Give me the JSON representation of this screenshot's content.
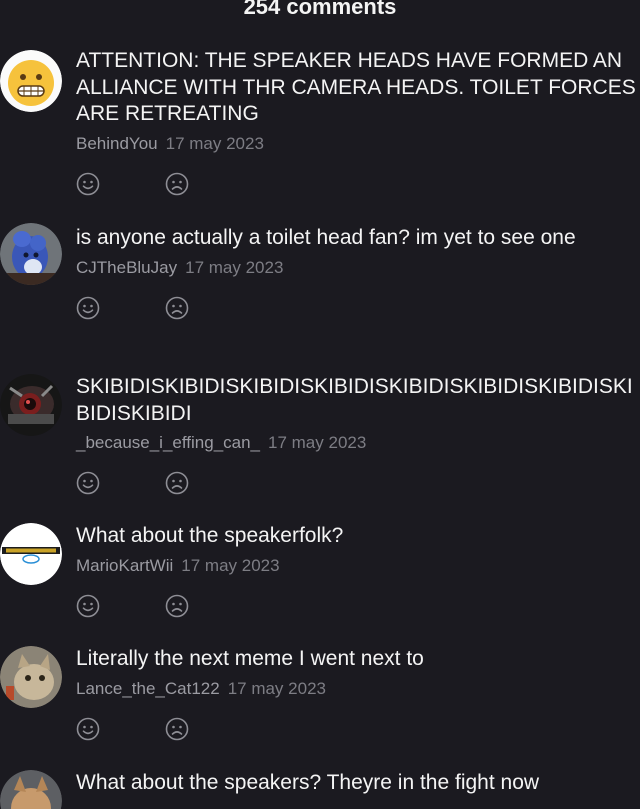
{
  "header": {
    "title": "254 comments"
  },
  "comments": [
    {
      "avatar_icon": "grimace-emoji-avatar-icon",
      "text": "ATTENTION: THE SPEAKER HEADS HAVE FORMED AN ALLIANCE WITH THR CAMERA HEADS. TOILET FORCES ARE RETREATING",
      "author": "BehindYou",
      "date": "17 may 2023"
    },
    {
      "avatar_icon": "blue-creature-avatar-icon",
      "text": "is anyone actually a toilet head fan? im yet to see one",
      "author": "CJTheBluJay",
      "date": "17 may 2023"
    },
    {
      "avatar_icon": "dark-robot-avatar-icon",
      "text": "SKIBIDISKIBIDISKIBIDISKIBIDISKIBIDISKIBIDISKIBIDISKIBIDISKIBIDI",
      "author": "_because_i_effing_can_",
      "date": "17 may 2023"
    },
    {
      "avatar_icon": "mario-kart-wii-logo-avatar-icon",
      "text": "What about the speakerfolk?",
      "author": "MarioKartWii",
      "date": "17 may 2023"
    },
    {
      "avatar_icon": "cat-photo-avatar-icon",
      "text": "Literally the next meme I went next to",
      "author": "Lance_the_Cat122",
      "date": "17 may 2023"
    },
    {
      "avatar_icon": "dog-photo-avatar-icon",
      "text": "What about the speakers? Theyre in the fight now",
      "author": "",
      "date": ""
    }
  ],
  "reactions": {
    "like_icon": "smile-icon",
    "dislike_icon": "frown-icon"
  },
  "colors": {
    "background": "#1b1a20",
    "text": "#f4f4f4",
    "meta": "#9b9ba2",
    "icon": "#8e8e95"
  }
}
